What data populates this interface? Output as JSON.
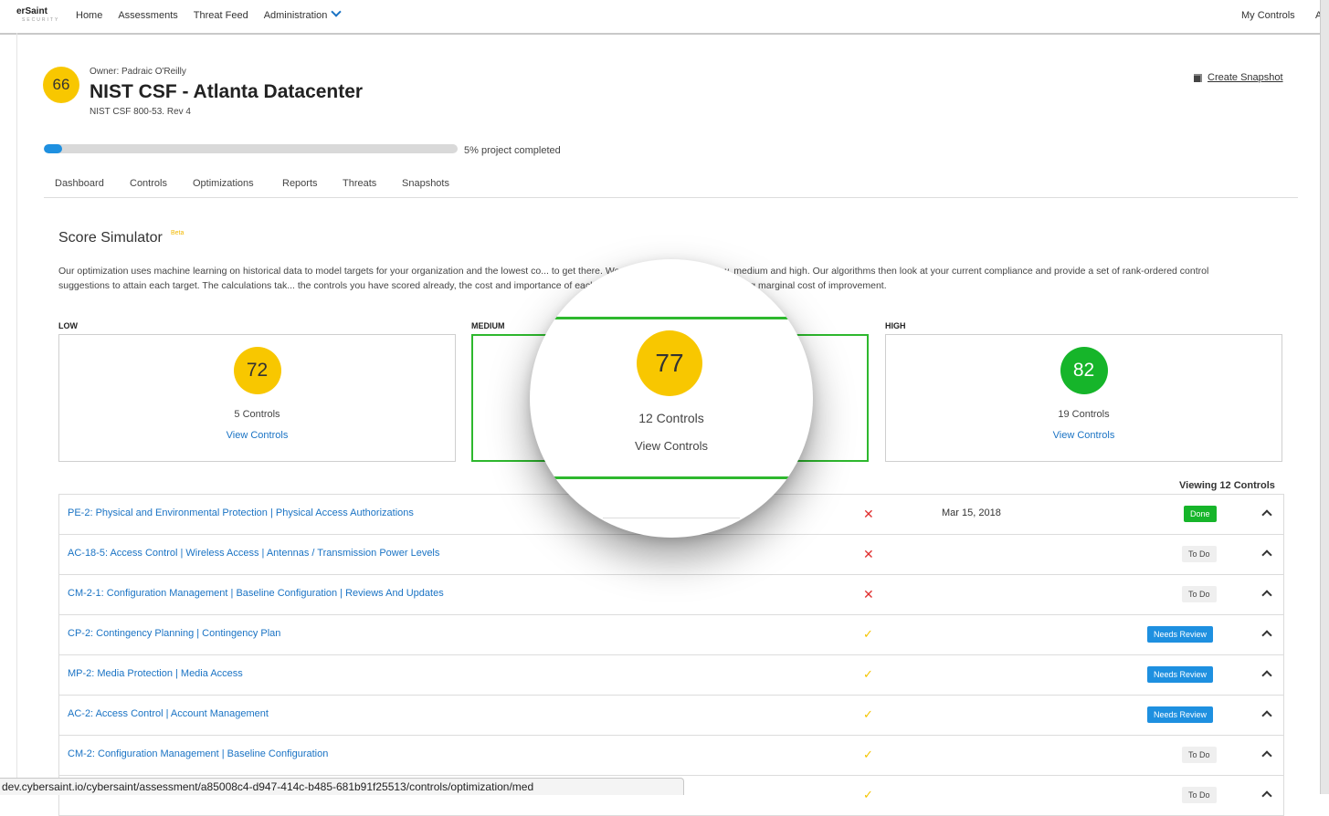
{
  "brand": {
    "name": "erSaint",
    "tagline": "SECURITY"
  },
  "nav": {
    "items": [
      "Home",
      "Assessments",
      "Threat Feed",
      "Administration"
    ],
    "right": "My Controls",
    "right_extra": "A"
  },
  "header": {
    "score": "66",
    "owner": "Owner: Padraic O'Reilly",
    "title": "NIST CSF - Atlanta Datacenter",
    "framework": "NIST CSF 800-53. Rev 4",
    "snapshot_label": "Create Snapshot"
  },
  "progress": {
    "percent": 5,
    "label": "5% project completed"
  },
  "tabs": [
    "Dashboard",
    "Controls",
    "Optimizations",
    "Reports",
    "Threats",
    "Snapshots"
  ],
  "simulator": {
    "title": "Score Simulator",
    "beta": "Beta",
    "description": "Our optimization uses machine learning on historical data to model targets for your organization and the lowest co... to get there. We provide three scores, low, medium and high. Our algorithms then look at your current compliance and provide a set of rank-ordered control suggestions to attain each target. The calculations tak... the controls you have scored already, the cost and importance of each control in general, and the increasing marginal cost of improvement."
  },
  "targets": {
    "low": {
      "label": "LOW",
      "score": "72",
      "controls": "5 Controls",
      "link": "View Controls"
    },
    "medium": {
      "label": "MEDIUM",
      "score": "77",
      "controls": "12 Controls",
      "link": "View Controls"
    },
    "high": {
      "label": "HIGH",
      "score": "82",
      "controls": "19 Controls",
      "link": "View Controls"
    }
  },
  "viewing": "Viewing 12 Controls",
  "rows": [
    {
      "title": "PE-2: Physical and Environmental Protection | Physical Access Authorizations",
      "mark": "✕",
      "date": "Mar 15, 2018",
      "status": "Done"
    },
    {
      "title": "AC-18-5: Access Control | Wireless Access | Antennas / Transmission Power Levels",
      "mark": "✕",
      "date": "",
      "status": "To Do"
    },
    {
      "title": "CM-2-1: Configuration Management | Baseline Configuration | Reviews And Updates",
      "mark": "✕",
      "date": "",
      "status": "To Do"
    },
    {
      "title": "CP-2: Contingency Planning | Contingency Plan",
      "mark": "✓",
      "date": "",
      "status": "Needs Review"
    },
    {
      "title": "MP-2: Media Protection | Media Access",
      "mark": "✓",
      "date": "",
      "status": "Needs Review"
    },
    {
      "title": "AC-2: Access Control | Account Management",
      "mark": "✓",
      "date": "",
      "status": "Needs Review"
    },
    {
      "title": "CM-2: Configuration Management | Baseline Configuration",
      "mark": "✓",
      "date": "",
      "status": "To Do"
    },
    {
      "title": "",
      "mark": "✓",
      "date": "",
      "status": "To Do"
    }
  ],
  "statusbar": "dev.cybersaint.io/cybersaint/assessment/a85008c4-d947-414c-b485-681b91f25513/controls/optimization/med",
  "colors": {
    "accent": "#1a73c4",
    "score_yellow": "#f8c700",
    "score_green": "#16b52a",
    "selected_border": "#2eb82e",
    "error_red": "#e03030"
  }
}
